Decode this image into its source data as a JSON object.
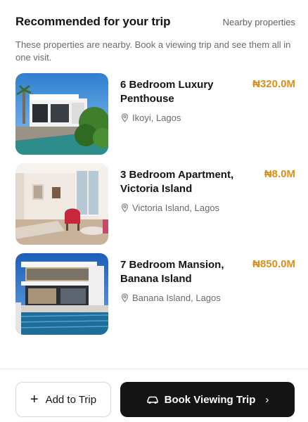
{
  "header": {
    "title": "Recommended for your trip",
    "link": "Nearby properties"
  },
  "description": "These properties are nearby. Book a viewing trip and see them all in one visit.",
  "properties": [
    {
      "name": "6 Bedroom Luxury Penthouse",
      "price": "₦320.0M",
      "location": "Ikoyi, Lagos",
      "image": "penthouse-photo"
    },
    {
      "name": "3 Bedroom Apartment, Victoria Island",
      "price": "₦8.0M",
      "location": "Victoria Island, Lagos",
      "image": "apartment-interior-photo"
    },
    {
      "name": "7 Bedroom Mansion, Banana Island",
      "price": "₦850.0M",
      "location": "Banana Island, Lagos",
      "image": "mansion-pool-photo"
    }
  ],
  "footer": {
    "add_label": "Add to Trip",
    "add_icon": "plus-icon",
    "book_label": "Book Viewing Trip",
    "book_icon": "car-icon",
    "book_arrow": "chevron-right-icon"
  },
  "colors": {
    "price": "#d6911c",
    "primary_button": "#141414",
    "muted_text": "#6a6a6a"
  }
}
